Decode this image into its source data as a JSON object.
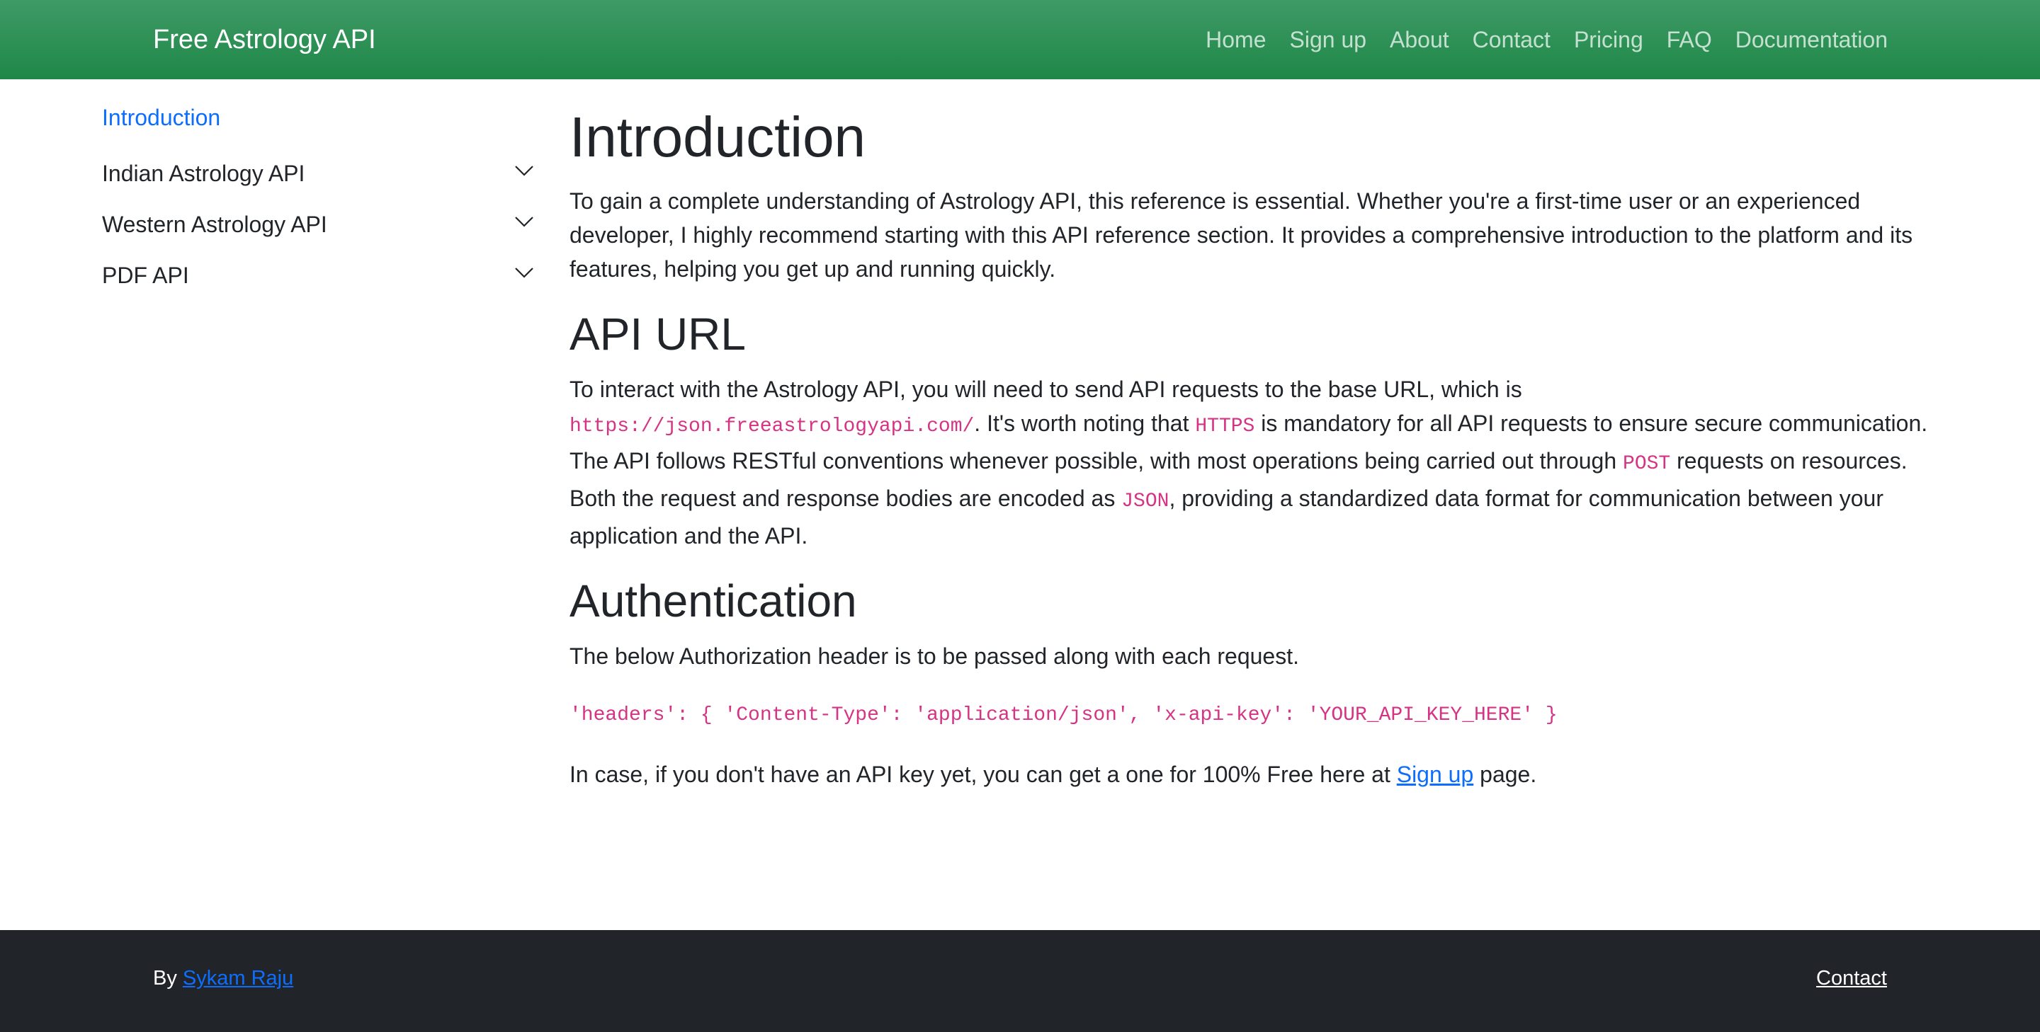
{
  "navbar": {
    "brand": "Free Astrology API",
    "links": [
      "Home",
      "Sign up",
      "About",
      "Contact",
      "Pricing",
      "FAQ",
      "Documentation"
    ]
  },
  "sidebar": {
    "active": "Introduction",
    "items": [
      {
        "label": "Indian Astrology API",
        "icon": "chevron-down-icon"
      },
      {
        "label": "Western Astrology API",
        "icon": "chevron-down-icon"
      },
      {
        "label": "PDF API",
        "icon": "chevron-down-icon"
      }
    ]
  },
  "main": {
    "title": "Introduction",
    "intro_text": "To gain a complete understanding of Astrology API, this reference is essential. Whether you're a first-time user or an experienced developer, I highly recommend starting with this API reference section. It provides a comprehensive introduction to the platform and its features, helping you get up and running quickly.",
    "api_url_heading": "API URL",
    "api_url_p1": "To interact with the Astrology API, you will need to send API requests to the base URL, which is ",
    "api_url_code_url": "https://json.freeastrologyapi.com/",
    "api_url_p2": ". It's worth noting that ",
    "api_url_code_https": "HTTPS",
    "api_url_p3": " is mandatory for all API requests to ensure secure communication. The API follows RESTful conventions whenever possible, with most operations being carried out through ",
    "api_url_code_post": "POST",
    "api_url_p4": " requests on resources. Both the request and response bodies are encoded as ",
    "api_url_code_json": "JSON",
    "api_url_p5": ", providing a standardized data format for communication between your application and the API.",
    "auth_heading": "Authentication",
    "auth_text": "The below Authorization header is to be passed along with each request.",
    "auth_code": "'headers': { 'Content-Type': 'application/json', 'x-api-key': 'YOUR_API_KEY_HERE' }",
    "signup_p1": "In case, if you don't have an API key yet, you can get a one for 100% Free here at ",
    "signup_link": "Sign up",
    "signup_p2": " page."
  },
  "footer": {
    "by": "By ",
    "author": "Sykam Raju",
    "contact": "Contact"
  },
  "colors": {
    "navbar_green": "#1e8847",
    "link_blue": "#0d6efd",
    "code_pink": "#d63384",
    "footer_dark": "#212529"
  }
}
